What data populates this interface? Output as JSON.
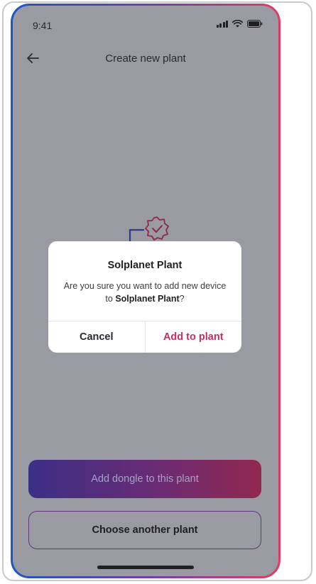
{
  "status_bar": {
    "time": "9:41",
    "icons": [
      "signal-icon",
      "wifi-icon",
      "battery-icon"
    ]
  },
  "nav": {
    "title": "Create new plant",
    "back_icon": "arrow-left-icon"
  },
  "illustration": {
    "icon": "verified-badge-icon"
  },
  "dialog": {
    "title": "Solplanet Plant",
    "message_prefix": "Are you sure you want to add new device to ",
    "message_plant": "Solplanet Plant",
    "message_suffix": "?",
    "cancel_label": "Cancel",
    "confirm_label": "Add to plant"
  },
  "buttons": {
    "primary_label": "Add dongle to this plant",
    "secondary_label": "Choose another plant"
  },
  "colors": {
    "accent": "#c42f63",
    "overlay": "#9a9aa2",
    "gradient_start": "#1c57c4",
    "gradient_end": "#e23c5f"
  }
}
